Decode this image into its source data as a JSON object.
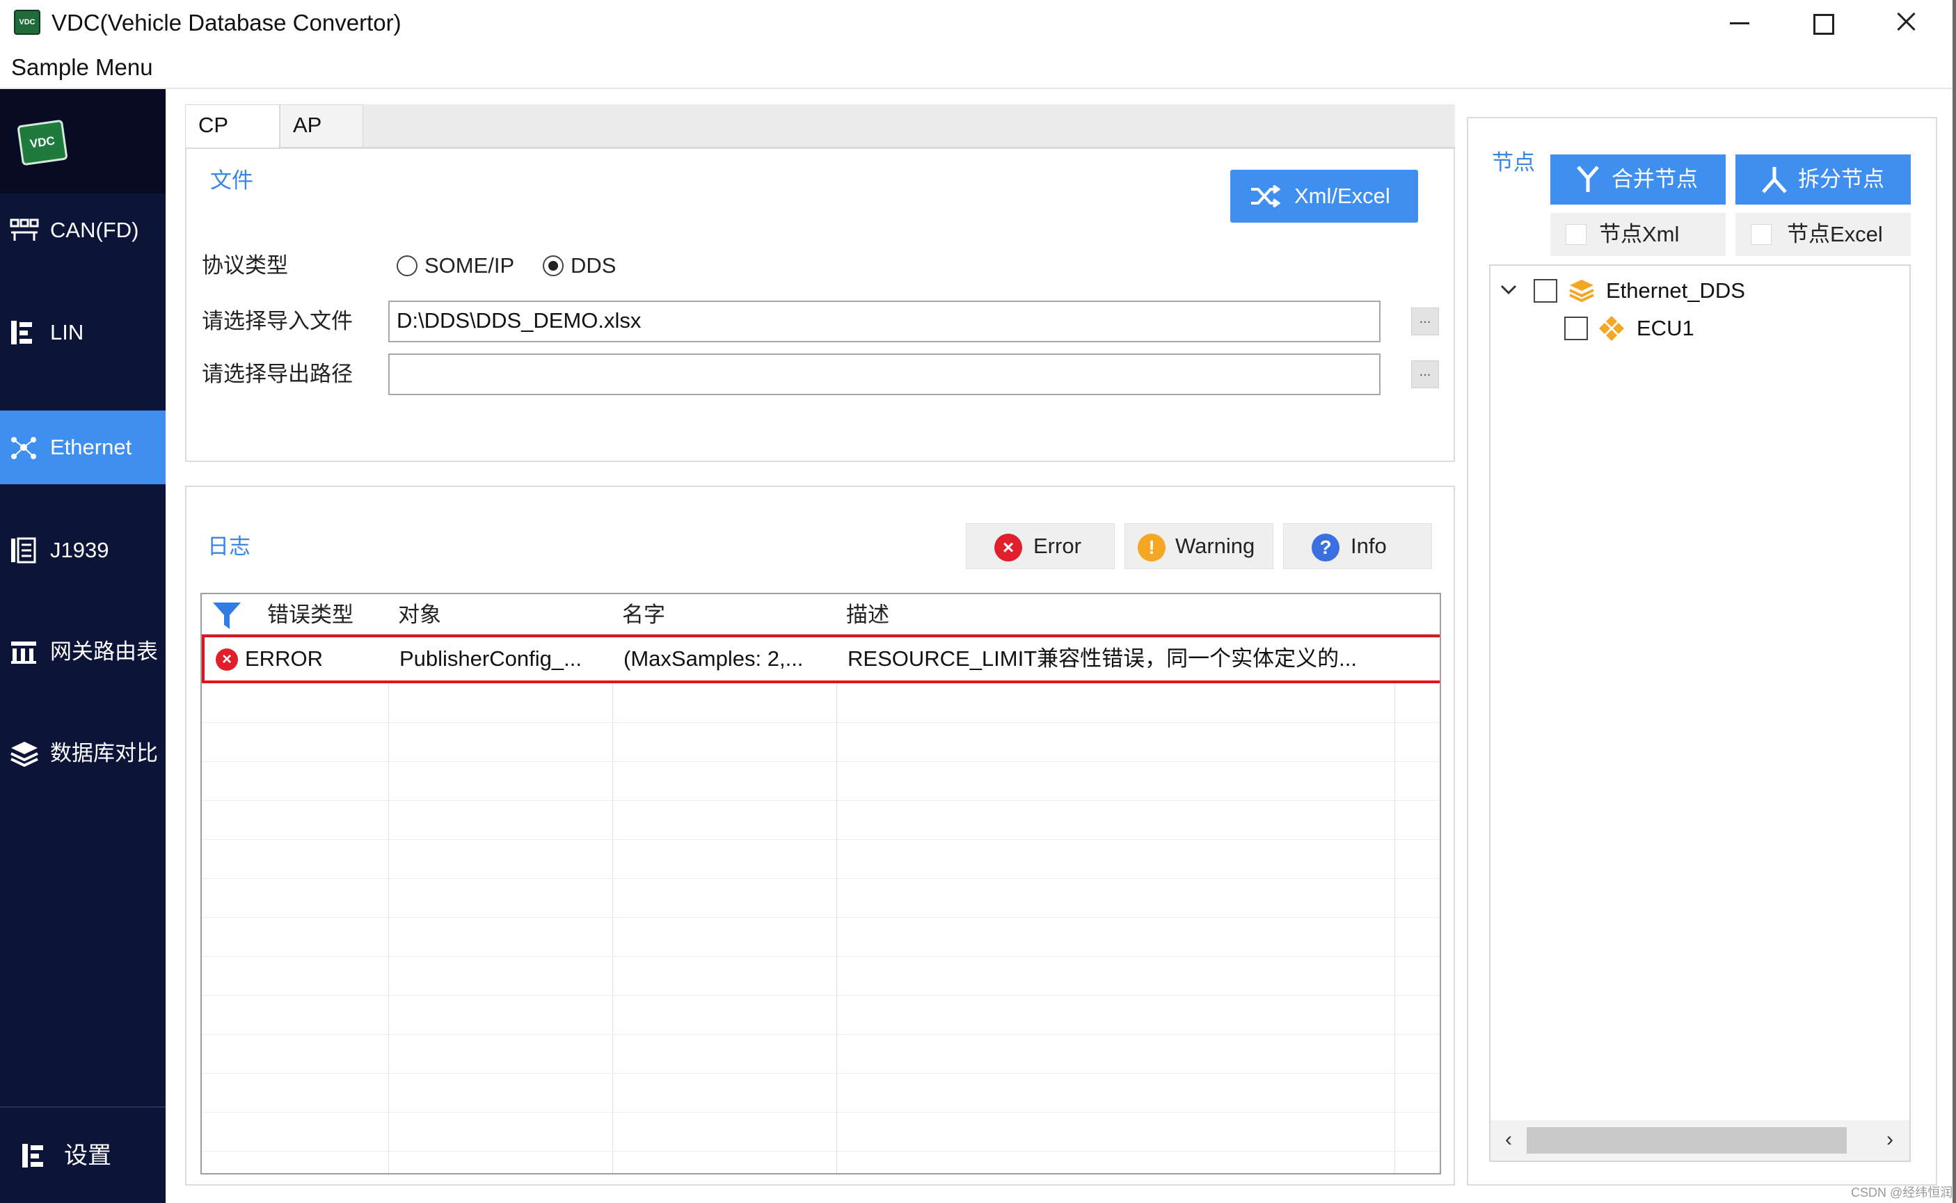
{
  "window": {
    "title": "VDC(Vehicle Database Convertor)",
    "logo_text": "VDC"
  },
  "menu": {
    "items": [
      "Sample Menu"
    ]
  },
  "sidebar": {
    "logo_text": "VDC",
    "items": [
      {
        "label": "CAN(FD)",
        "icon": "can-network-icon"
      },
      {
        "label": "LIN",
        "icon": "lin-tree-icon"
      },
      {
        "label": "Ethernet",
        "icon": "ethernet-hub-icon",
        "active": true
      },
      {
        "label": "J1939",
        "icon": "j1939-doc-icon"
      },
      {
        "label": "网关路由表",
        "icon": "gateway-routing-icon"
      },
      {
        "label": "数据库对比",
        "icon": "database-compare-icon"
      }
    ],
    "settings_label": "设置"
  },
  "tabs": {
    "cp": "CP",
    "ap": "AP"
  },
  "file_section": {
    "title": "文件",
    "convert_button": "Xml/Excel",
    "protocol_label": "协议类型",
    "protocol_options": [
      "SOME/IP",
      "DDS"
    ],
    "protocol_selected": "DDS",
    "import_label": "请选择导入文件",
    "import_value": "D:\\DDS\\DDS_DEMO.xlsx",
    "export_label": "请选择导出路径",
    "export_value": "",
    "browse_label": "..."
  },
  "log_section": {
    "title": "日志",
    "filters": {
      "error": "Error",
      "warning": "Warning",
      "info": "Info"
    },
    "columns": [
      "错误类型",
      "对象",
      "名字",
      "描述"
    ],
    "rows": [
      {
        "type": "ERROR",
        "object": "PublisherConfig_...",
        "name": "(MaxSamples: 2,...",
        "description": "RESOURCE_LIMIT兼容性错误，同一个实体定义的..."
      }
    ]
  },
  "node_panel": {
    "title": "节点",
    "merge_button": "合并节点",
    "split_button": "拆分节点",
    "xml_option": "节点Xml",
    "excel_option": "节点Excel",
    "tree": [
      {
        "label": "Ethernet_DDS",
        "expanded": true,
        "children": [
          {
            "label": "ECU1"
          }
        ]
      }
    ]
  },
  "watermark": "CSDN @经纬恒润",
  "colors": {
    "sidebar_bg": "#0c1437",
    "accent_blue": "#3f8ff0",
    "error_red": "#e0151b",
    "warning_orange": "#f5a623",
    "info_blue": "#3a6fe0"
  }
}
